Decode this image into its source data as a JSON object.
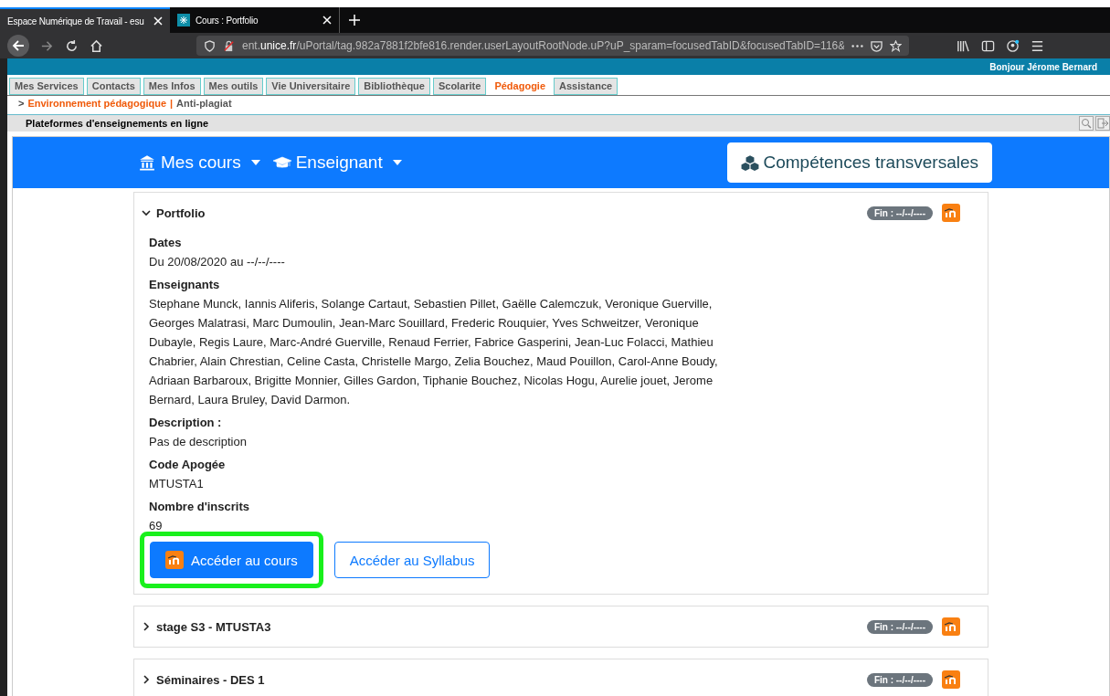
{
  "browser": {
    "tabs": [
      {
        "title": "Espace Numérique de Travail - esu",
        "selected": true,
        "favicon": false
      },
      {
        "title": "Cours : Portfolio",
        "selected": false,
        "favicon": true
      }
    ],
    "url": {
      "host_prefix": "ent.",
      "host_main": "unice.fr",
      "path": "/uPortal/tag.982a7881f2bfe816.render.userLayoutRootNode.uP?uP_sparam=focusedTabID&focusedTabID=116&"
    }
  },
  "site": {
    "greeting": "Bonjour Jérome Bernard"
  },
  "portal_tabs": [
    {
      "label": "Mes Services",
      "selected": false
    },
    {
      "label": "Contacts",
      "selected": false
    },
    {
      "label": "Mes Infos",
      "selected": false
    },
    {
      "label": "Mes outils",
      "selected": false
    },
    {
      "label": "Vie Universitaire",
      "selected": false
    },
    {
      "label": "Bibliothèque",
      "selected": false
    },
    {
      "label": "Scolarite",
      "selected": false
    },
    {
      "label": "Pédagogie",
      "selected": true
    },
    {
      "label": "Assistance",
      "selected": false
    }
  ],
  "breadcrumb": {
    "prefix": ">",
    "items": [
      {
        "label": "Environnement pédagogique",
        "selected": true
      },
      {
        "label": "Anti-plagiat",
        "selected": false
      }
    ],
    "separator": "|"
  },
  "portlet": {
    "title": "Plateformes d'enseignements en ligne"
  },
  "navbar": {
    "menus": [
      "Mes cours",
      "Enseignant"
    ],
    "button": "Compétences transversales"
  },
  "courses": [
    {
      "title": "Portfolio",
      "expanded": true,
      "badge": "Fin : --/--/----",
      "sections": [
        {
          "label": "Dates",
          "value": "Du 20/08/2020 au --/--/----"
        },
        {
          "label": "Enseignants",
          "value": "Stephane Munck, Iannis Aliferis, Solange Cartaut, Sebastien Pillet, Gaëlle Calemczuk, Veronique Guerville, Georges Malatrasi, Marc Dumoulin, Jean-Marc Souillard, Frederic Rouquier, Yves Schweitzer, Veronique Dubayle, Regis Laure, Marc-André Guerville, Renaud Ferrier, Fabrice Gasperini, Jean-Luc Folacci, Mathieu Chabrier, Alain Chrestian, Celine Casta, Christelle Margo, Zelia Bouchez, Maud Pouillon, Carol-Anne Boudy, Adriaan Barbaroux, Brigitte Monnier, Gilles Gardon, Tiphanie Bouchez, Nicolas Hogu, Aurelie jouet, Jerome Bernard, Laura Bruley, David Darmon."
        },
        {
          "label": "Description :",
          "value": "Pas de description"
        },
        {
          "label": "Code Apogée",
          "value": "MTUSTA1"
        },
        {
          "label": "Nombre d'inscrits",
          "value": "69"
        }
      ],
      "buttons": [
        {
          "label": "Accéder au cours",
          "kind": "primary",
          "highlighted": true
        },
        {
          "label": "Accéder au Syllabus",
          "kind": "outline",
          "highlighted": false
        }
      ]
    },
    {
      "title": "stage S3 - MTUSTA3",
      "expanded": false,
      "badge": "Fin : --/--/----"
    },
    {
      "title": "Séminaires - DES 1",
      "expanded": false,
      "badge": "Fin : --/--/----"
    }
  ]
}
